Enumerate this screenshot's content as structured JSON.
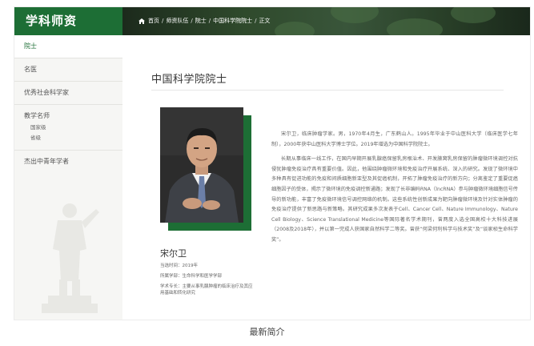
{
  "sidebar": {
    "title": "学科师资",
    "items": [
      {
        "label": "院士",
        "active": true
      },
      {
        "label": "名医"
      },
      {
        "label": "优秀社会科学家"
      }
    ],
    "group": {
      "title": "教学名师",
      "subs": [
        "国家级",
        "省级"
      ]
    },
    "last_item": "杰出中青年学者"
  },
  "breadcrumb": {
    "items": [
      "首页",
      "师资队伍",
      "院士",
      "中国科学院院士",
      "正文"
    ]
  },
  "page": {
    "title": "中国科学院院士",
    "person": {
      "name": "宋尔卫",
      "elected": "当选时间：2019年",
      "unit": "所属学部：生命科学和医学学部",
      "field": "学术专长：主要从事乳腺肿瘤的临床治疗及其应用基础和转化研究"
    },
    "bio": [
      "宋尔卫，临床肿瘤学家。男，1970年4月生，广东鹤山人。1995年毕业于中山医科大学（临床医学七年制），2000年获中山医科大学博士学位。2019年增选为中国科学院院士。",
      "长期从事临床一线工作，在国内早期开展乳腺癌保留乳房根治术、开发腋窝乳房保留的肿瘤微环境调控对抗侵犹肿瘤免疫治疗具有重要价值。因此，他围绕肿瘤微环境和免疫治疗开展系统、深入的研究。发现了微环境中多种具有促进功能的免疫和间质细胞新亚型及其促癌机制，开拓了肿瘤免疫治疗的新方向；分离鉴定了重要促癌细胞因子的受体，揭示了微环境的免疫调控新通路；发现了长非编码RNA（lncRNA）参与肿瘤微环境细胞信号传导的新功能，丰富了免疫微环境信号调控网络的机制。这些系统性创新成果为靶向肿瘤微环境及针对实体肿瘤的免疫治疗提供了新思路与新策略。其研究成果多次发表于Cell、Cancer Cell、Nature Immunology、Nature Cell Biology、Science Translational Medicine等国际著名学术期刊，曾两度入选全国高校十大科技进展（2008及2018年），并以第一完成人获国家自然科学二等奖。曾获“何梁何利科学与技术奖”及“谈家桢生命科学奖”。"
    ]
  },
  "caption": "最新简介",
  "colors": {
    "brand_green": "#1d6e35"
  }
}
